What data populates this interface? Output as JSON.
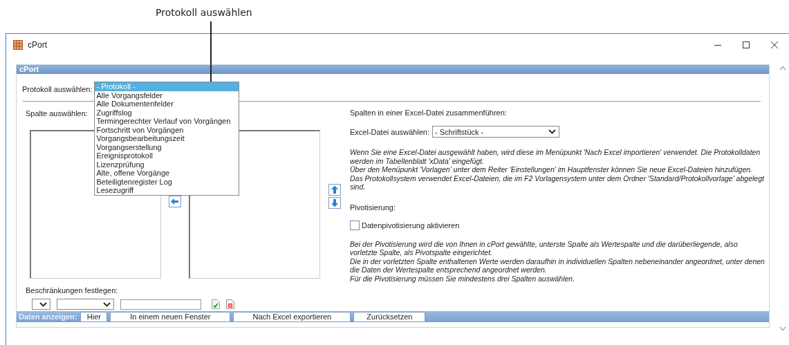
{
  "callout": {
    "text": "Protokoll auswählen"
  },
  "window": {
    "title": "cPort"
  },
  "panel": {
    "title": "cPort"
  },
  "protocol": {
    "label": "Protokoll auswählen:",
    "dropdown": {
      "expanded": true,
      "options": [
        {
          "label": "- Protokoll -",
          "selected": true
        },
        {
          "label": "Alle Vorgangsfelder",
          "selected": false
        },
        {
          "label": "Alle Dokumentenfelder",
          "selected": false
        },
        {
          "label": "Zugriffslog",
          "selected": false
        },
        {
          "label": "Termingerechter Verlauf von Vorgängen",
          "selected": false
        },
        {
          "label": "Fortschritt von Vorgängen",
          "selected": false
        },
        {
          "label": "Vorgangsbearbeitungszeit",
          "selected": false
        },
        {
          "label": "Vorgangserstellung",
          "selected": false
        },
        {
          "label": "Ereignisprotokoll",
          "selected": false
        },
        {
          "label": "Lizenzprüfung",
          "selected": false
        },
        {
          "label": "Alte, offene Vorgänge",
          "selected": false
        },
        {
          "label": "Beteiligtenregister Log",
          "selected": false
        },
        {
          "label": "Lesezugriff",
          "selected": false
        }
      ]
    }
  },
  "columns": {
    "label": "Spalte auswählen:"
  },
  "restrictions": {
    "label": "Beschränkungen festlegen:"
  },
  "merge": {
    "heading": "Spalten in einer Excel-Datei zusammenführen:",
    "excel_label": "Excel-Datei auswählen:",
    "excel_value": "- Schriftstück -",
    "notes": [
      "Wenn Sie eine Excel-Datei ausgewählt haben, wird diese im Menüpunkt 'Nach Excel importieren' verwendet. Die Protokolldaten werden im Tabellenblatt 'xData' eingefügt.",
      "Über den Menüpunkt 'Vorlagen' unter dem Reiter 'Einstellungen' im Hauptfenster können Sie neue Excel-Dateien hinzufügen.",
      "Das Protokollsystem verwendet Excel-Dateien, die im F2 Vorlagensystem unter dem Ordner 'Standard/Protokollvorlage' abgelegt sind."
    ]
  },
  "pivot": {
    "heading": "Pivotisierung:",
    "checkbox": {
      "label": "Datenpivotisierung aktivieren",
      "checked": false
    },
    "notes": [
      "Bei der Pivotisierung wird die von Ihnen in cPort gewählte, unterste Spalte als Wertespalte und die darüberliegende, also vorletzte Spalte, als Pivotspalte eingerichtet.",
      "Die in der vorletzten Spalte enthaltenen Werte werden daraufhin in individuellen Spalten nebeneinander angeordnet, unter denen die Daten der Wertespalte entsprechend angeordnet werden.",
      "Für die Pivotisierung müssen Sie mindestens drei Spalten auswählen."
    ]
  },
  "footer": {
    "label": "Daten anzeigen:",
    "buttons": [
      "Hier",
      "In einem neuen Fenster",
      "Nach Excel exportieren",
      "Zurücksetzen"
    ]
  }
}
